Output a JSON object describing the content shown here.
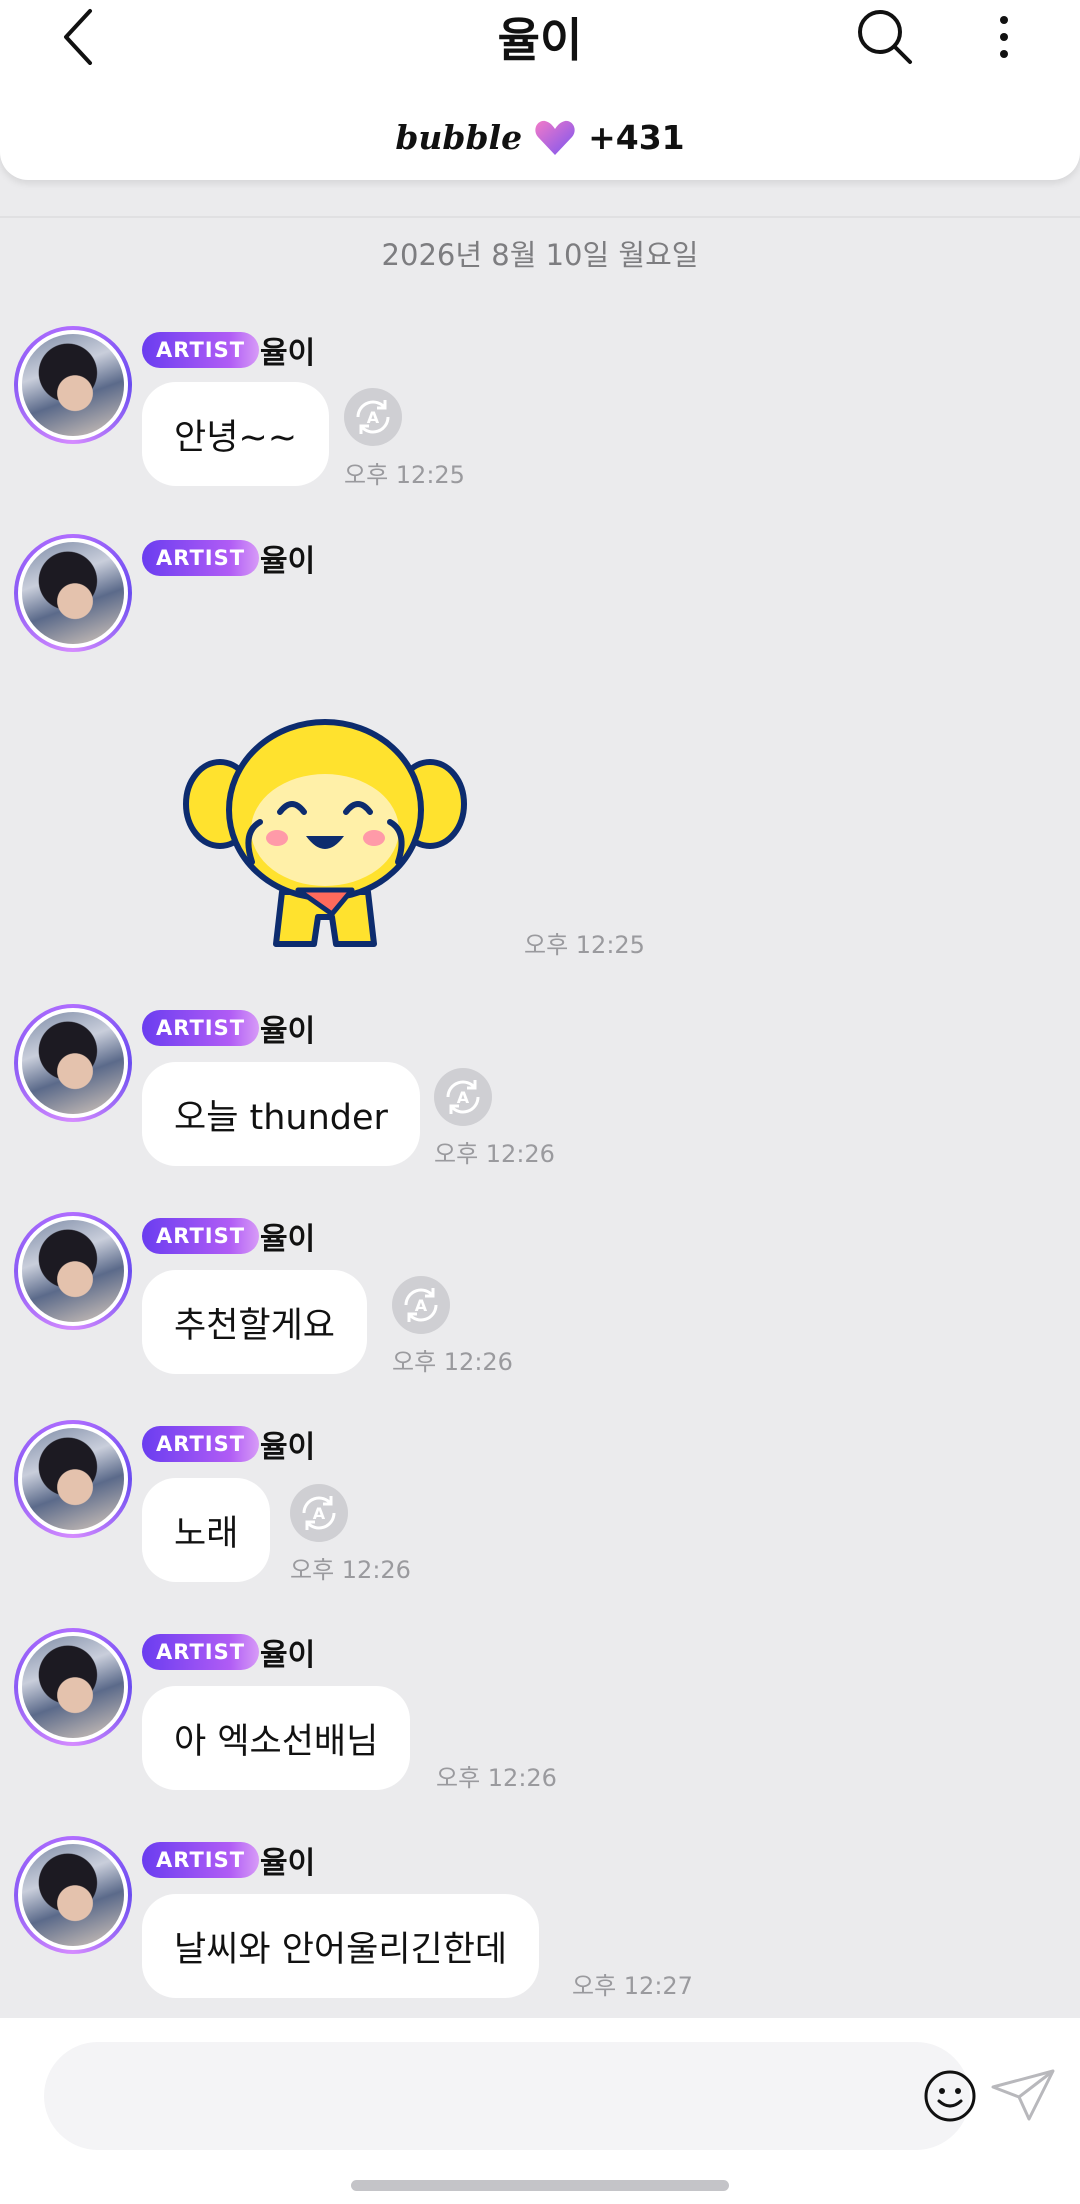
{
  "header": {
    "title": "율이",
    "brand": "bubble",
    "bubble_count": "+431"
  },
  "date_separator": "2026년 8월 10일 월요일",
  "messages": [
    {
      "badge": "ARTIST",
      "sender": "율이",
      "text": "안녕~~",
      "time": "오후 12:25",
      "translatable": true
    },
    {
      "badge": "ARTIST",
      "sender": "율이",
      "sticker": "yellow-monkey-sticker",
      "time": "오후 12:25"
    },
    {
      "badge": "ARTIST",
      "sender": "율이",
      "text": "오늘 thunder",
      "time": "오후 12:26",
      "translatable": true
    },
    {
      "badge": "ARTIST",
      "sender": "율이",
      "text": "추천할게요",
      "time": "오후 12:26",
      "translatable": true
    },
    {
      "badge": "ARTIST",
      "sender": "율이",
      "text": "노래",
      "time": "오후 12:26",
      "translatable": true
    },
    {
      "badge": "ARTIST",
      "sender": "율이",
      "text": "아 엑소선배님",
      "time": "오후 12:26",
      "translatable": false
    },
    {
      "badge": "ARTIST",
      "sender": "율이",
      "text": "날씨와 안어울리긴한데",
      "time": "오후 12:27",
      "translatable": false
    }
  ],
  "input": {
    "placeholder": ""
  },
  "colors": {
    "background": "#ebebed",
    "badge_gradient_start": "#6a3df0",
    "badge_gradient_end": "#d79bf7",
    "heart_pink": "#f27ac8",
    "heart_purple": "#8a5cf0"
  },
  "icons": {
    "back": "chevron-left-icon",
    "search": "search-icon",
    "more": "more-vertical-icon",
    "translate": "translate-icon",
    "emoji": "emoji-icon",
    "send": "send-icon",
    "heart": "heart-icon"
  }
}
